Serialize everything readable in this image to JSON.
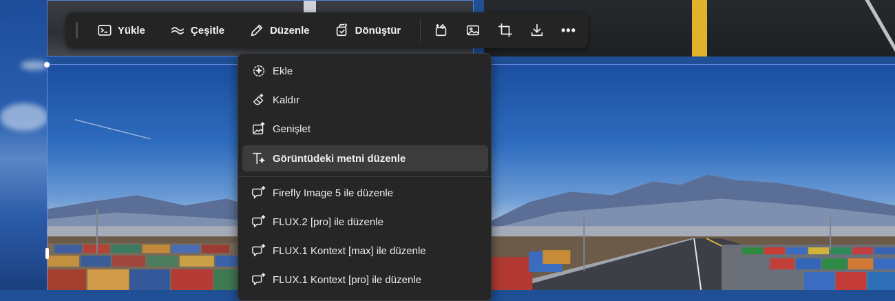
{
  "toolbar": {
    "buttons": [
      {
        "label": "Yükle",
        "icon": "upload-terminal-icon"
      },
      {
        "label": "Çeşitle",
        "icon": "variations-wave-icon"
      },
      {
        "label": "Düzenle",
        "icon": "pencil-icon"
      },
      {
        "label": "Dönüştür",
        "icon": "transform-icon"
      }
    ],
    "icon_buttons": [
      "generative-fill-icon",
      "image-icon",
      "crop-icon",
      "download-icon",
      "more-options-icon"
    ],
    "more_label": "•••"
  },
  "menu": {
    "items": [
      {
        "label": "Ekle",
        "icon": "add-object-icon"
      },
      {
        "label": "Kaldır",
        "icon": "remove-eraser-icon"
      },
      {
        "label": "Genişlet",
        "icon": "expand-image-icon"
      },
      {
        "label": "Görüntüdeki metni düzenle",
        "icon": "edit-text-icon",
        "active": true
      },
      {
        "label": "Firefly Image 5 ile düzenle",
        "icon": "ai-chat-edit-icon"
      },
      {
        "label": "FLUX.2 [pro] ile düzenle",
        "icon": "ai-chat-edit-icon"
      },
      {
        "label": "FLUX.1 Kontext [max] ile düzenle",
        "icon": "ai-chat-edit-icon"
      },
      {
        "label": "FLUX.1 Kontext [pro] ile düzenle",
        "icon": "ai-chat-edit-icon"
      }
    ]
  },
  "colors": {
    "toolbar_bg": "#242424",
    "menu_bg": "#262626",
    "menu_active_bg": "#3c3c3c",
    "selection": "#5a7fe0"
  }
}
